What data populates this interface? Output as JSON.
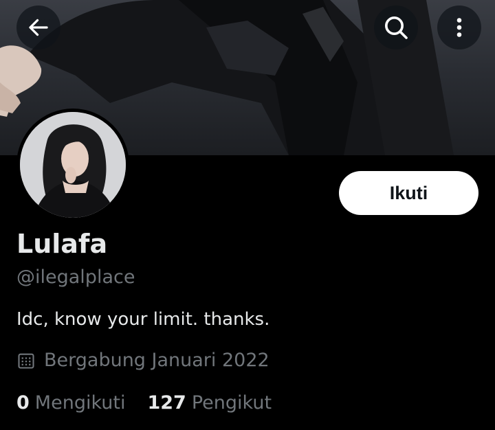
{
  "profile": {
    "display_name": "Lulafa",
    "handle": "@ilegalplace",
    "bio": "Idc, know your limit. thanks.",
    "joined": "Bergabung Januari 2022",
    "follow_label": "Ikuti"
  },
  "stats": {
    "following_count": "0",
    "following_label": "Mengikuti",
    "followers_count": "127",
    "followers_label": "Pengikut"
  },
  "icons": {
    "back": "arrow-left-icon",
    "search": "search-icon",
    "more": "more-vertical-icon",
    "calendar": "calendar-icon"
  },
  "colors": {
    "background": "#000000",
    "text_primary": "#e7e9ea",
    "text_secondary": "#71767b",
    "button_bg": "#ffffff",
    "button_text": "#0f1419"
  }
}
